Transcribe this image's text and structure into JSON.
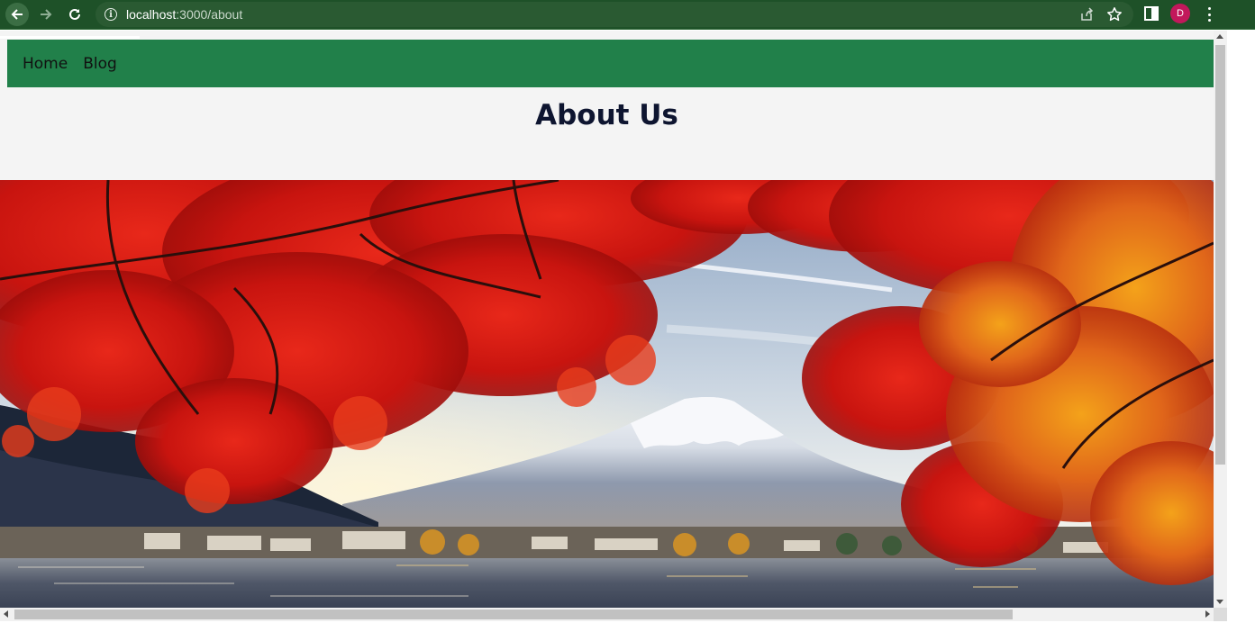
{
  "browser": {
    "url_host": "localhost",
    "url_path": ":3000/about",
    "profile_initial": "D",
    "profile_color": "#c2185b",
    "theme_color": "#1e5128"
  },
  "nav": {
    "color": "#21804a",
    "items": [
      {
        "label": "Home"
      },
      {
        "label": "Blog"
      }
    ]
  },
  "page": {
    "title": "About Us",
    "hero_image": "mount-fuji-autumn-maple-lake"
  }
}
